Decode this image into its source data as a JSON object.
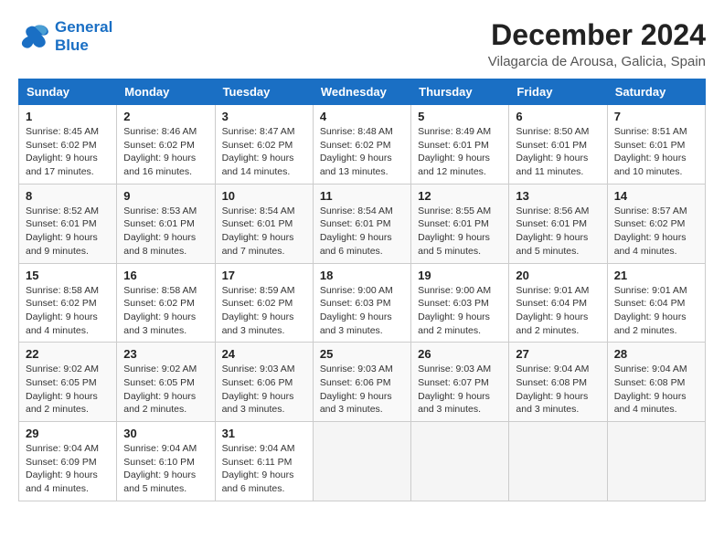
{
  "header": {
    "logo_line1": "General",
    "logo_line2": "Blue",
    "month": "December 2024",
    "location": "Vilagarcia de Arousa, Galicia, Spain"
  },
  "weekdays": [
    "Sunday",
    "Monday",
    "Tuesday",
    "Wednesday",
    "Thursday",
    "Friday",
    "Saturday"
  ],
  "weeks": [
    [
      {
        "day": "1",
        "info": "Sunrise: 8:45 AM\nSunset: 6:02 PM\nDaylight: 9 hours\nand 17 minutes."
      },
      {
        "day": "2",
        "info": "Sunrise: 8:46 AM\nSunset: 6:02 PM\nDaylight: 9 hours\nand 16 minutes."
      },
      {
        "day": "3",
        "info": "Sunrise: 8:47 AM\nSunset: 6:02 PM\nDaylight: 9 hours\nand 14 minutes."
      },
      {
        "day": "4",
        "info": "Sunrise: 8:48 AM\nSunset: 6:02 PM\nDaylight: 9 hours\nand 13 minutes."
      },
      {
        "day": "5",
        "info": "Sunrise: 8:49 AM\nSunset: 6:01 PM\nDaylight: 9 hours\nand 12 minutes."
      },
      {
        "day": "6",
        "info": "Sunrise: 8:50 AM\nSunset: 6:01 PM\nDaylight: 9 hours\nand 11 minutes."
      },
      {
        "day": "7",
        "info": "Sunrise: 8:51 AM\nSunset: 6:01 PM\nDaylight: 9 hours\nand 10 minutes."
      }
    ],
    [
      {
        "day": "8",
        "info": "Sunrise: 8:52 AM\nSunset: 6:01 PM\nDaylight: 9 hours\nand 9 minutes."
      },
      {
        "day": "9",
        "info": "Sunrise: 8:53 AM\nSunset: 6:01 PM\nDaylight: 9 hours\nand 8 minutes."
      },
      {
        "day": "10",
        "info": "Sunrise: 8:54 AM\nSunset: 6:01 PM\nDaylight: 9 hours\nand 7 minutes."
      },
      {
        "day": "11",
        "info": "Sunrise: 8:54 AM\nSunset: 6:01 PM\nDaylight: 9 hours\nand 6 minutes."
      },
      {
        "day": "12",
        "info": "Sunrise: 8:55 AM\nSunset: 6:01 PM\nDaylight: 9 hours\nand 5 minutes."
      },
      {
        "day": "13",
        "info": "Sunrise: 8:56 AM\nSunset: 6:01 PM\nDaylight: 9 hours\nand 5 minutes."
      },
      {
        "day": "14",
        "info": "Sunrise: 8:57 AM\nSunset: 6:02 PM\nDaylight: 9 hours\nand 4 minutes."
      }
    ],
    [
      {
        "day": "15",
        "info": "Sunrise: 8:58 AM\nSunset: 6:02 PM\nDaylight: 9 hours\nand 4 minutes."
      },
      {
        "day": "16",
        "info": "Sunrise: 8:58 AM\nSunset: 6:02 PM\nDaylight: 9 hours\nand 3 minutes."
      },
      {
        "day": "17",
        "info": "Sunrise: 8:59 AM\nSunset: 6:02 PM\nDaylight: 9 hours\nand 3 minutes."
      },
      {
        "day": "18",
        "info": "Sunrise: 9:00 AM\nSunset: 6:03 PM\nDaylight: 9 hours\nand 3 minutes."
      },
      {
        "day": "19",
        "info": "Sunrise: 9:00 AM\nSunset: 6:03 PM\nDaylight: 9 hours\nand 2 minutes."
      },
      {
        "day": "20",
        "info": "Sunrise: 9:01 AM\nSunset: 6:04 PM\nDaylight: 9 hours\nand 2 minutes."
      },
      {
        "day": "21",
        "info": "Sunrise: 9:01 AM\nSunset: 6:04 PM\nDaylight: 9 hours\nand 2 minutes."
      }
    ],
    [
      {
        "day": "22",
        "info": "Sunrise: 9:02 AM\nSunset: 6:05 PM\nDaylight: 9 hours\nand 2 minutes."
      },
      {
        "day": "23",
        "info": "Sunrise: 9:02 AM\nSunset: 6:05 PM\nDaylight: 9 hours\nand 2 minutes."
      },
      {
        "day": "24",
        "info": "Sunrise: 9:03 AM\nSunset: 6:06 PM\nDaylight: 9 hours\nand 3 minutes."
      },
      {
        "day": "25",
        "info": "Sunrise: 9:03 AM\nSunset: 6:06 PM\nDaylight: 9 hours\nand 3 minutes."
      },
      {
        "day": "26",
        "info": "Sunrise: 9:03 AM\nSunset: 6:07 PM\nDaylight: 9 hours\nand 3 minutes."
      },
      {
        "day": "27",
        "info": "Sunrise: 9:04 AM\nSunset: 6:08 PM\nDaylight: 9 hours\nand 3 minutes."
      },
      {
        "day": "28",
        "info": "Sunrise: 9:04 AM\nSunset: 6:08 PM\nDaylight: 9 hours\nand 4 minutes."
      }
    ],
    [
      {
        "day": "29",
        "info": "Sunrise: 9:04 AM\nSunset: 6:09 PM\nDaylight: 9 hours\nand 4 minutes."
      },
      {
        "day": "30",
        "info": "Sunrise: 9:04 AM\nSunset: 6:10 PM\nDaylight: 9 hours\nand 5 minutes."
      },
      {
        "day": "31",
        "info": "Sunrise: 9:04 AM\nSunset: 6:11 PM\nDaylight: 9 hours\nand 6 minutes."
      },
      null,
      null,
      null,
      null
    ]
  ]
}
